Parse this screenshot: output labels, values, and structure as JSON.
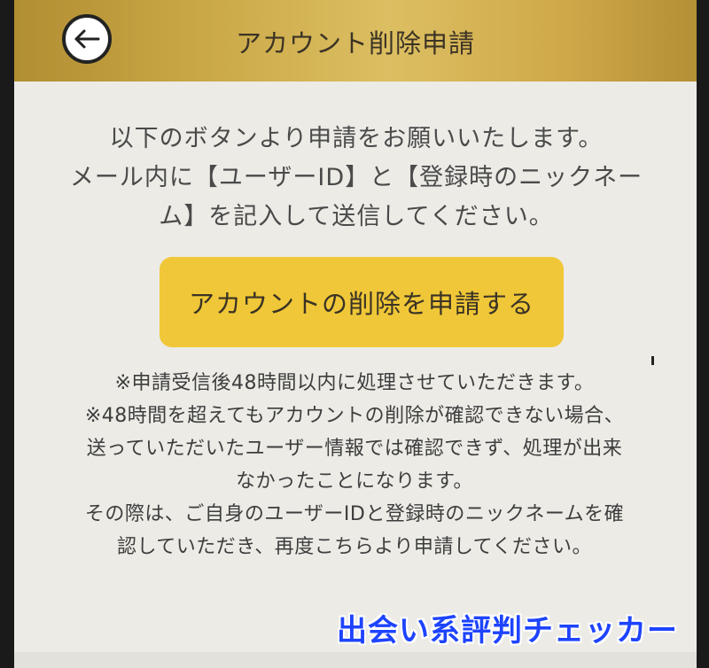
{
  "header": {
    "title": "アカウント削除申請",
    "back_icon": "arrow-left-icon"
  },
  "intro": {
    "lines": [
      "以下のボタンより申請をお願いいたします。",
      "メール内に【ユーザーID】と【登録時のニックネー",
      "ム】を記入して送信してください。"
    ]
  },
  "apply_button": {
    "label": "アカウントの削除を申請する",
    "color": "#f0c738"
  },
  "notes": {
    "lines": [
      "※申請受信後48時間以内に処理させていただきます。",
      "※48時間を超えてもアカウントの削除が確認できない場合、",
      "送っていただいたユーザー情報では確認できず、処理が出来",
      "なかったことになります。",
      "その際は、ご自身のユーザーIDと登録時のニックネームを確",
      "認していただき、再度こちらより申請してください。"
    ]
  },
  "watermark": {
    "text": "出会い系評判チェッカー",
    "color": "#1e44ff"
  },
  "colors": {
    "header_gold": "#c8a645",
    "background": "#ecebe6"
  }
}
